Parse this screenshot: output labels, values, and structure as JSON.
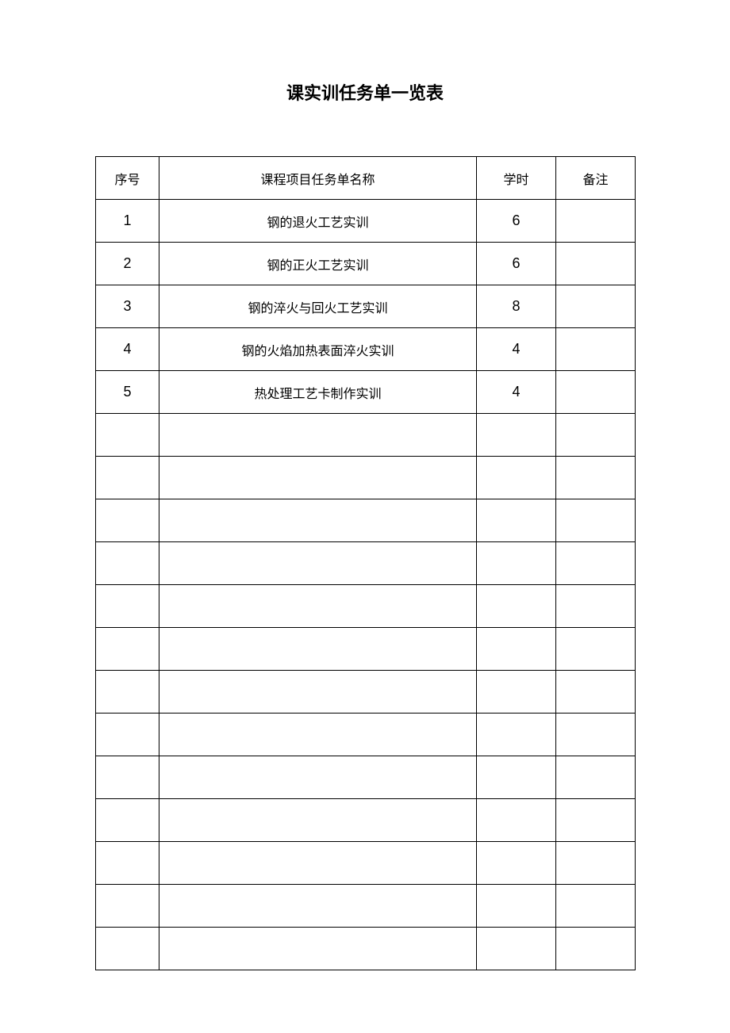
{
  "title": "课实训任务单一览表",
  "headers": {
    "index": "序号",
    "name": "课程项目任务单名称",
    "hours": "学时",
    "remark": "备注"
  },
  "rows": [
    {
      "index": "1",
      "name": "钢的退火工艺实训",
      "hours": "6",
      "remark": ""
    },
    {
      "index": "2",
      "name": "钢的正火工艺实训",
      "hours": "6",
      "remark": ""
    },
    {
      "index": "3",
      "name": "钢的淬火与回火工艺实训",
      "hours": "8",
      "remark": ""
    },
    {
      "index": "4",
      "name": "钢的火焰加热表面淬火实训",
      "hours": "4",
      "remark": ""
    },
    {
      "index": "5",
      "name": "热处理工艺卡制作实训",
      "hours": "4",
      "remark": ""
    },
    {
      "index": "",
      "name": "",
      "hours": "",
      "remark": ""
    },
    {
      "index": "",
      "name": "",
      "hours": "",
      "remark": ""
    },
    {
      "index": "",
      "name": "",
      "hours": "",
      "remark": ""
    },
    {
      "index": "",
      "name": "",
      "hours": "",
      "remark": ""
    },
    {
      "index": "",
      "name": "",
      "hours": "",
      "remark": ""
    },
    {
      "index": "",
      "name": "",
      "hours": "",
      "remark": ""
    },
    {
      "index": "",
      "name": "",
      "hours": "",
      "remark": ""
    },
    {
      "index": "",
      "name": "",
      "hours": "",
      "remark": ""
    },
    {
      "index": "",
      "name": "",
      "hours": "",
      "remark": ""
    },
    {
      "index": "",
      "name": "",
      "hours": "",
      "remark": ""
    },
    {
      "index": "",
      "name": "",
      "hours": "",
      "remark": ""
    },
    {
      "index": "",
      "name": "",
      "hours": "",
      "remark": ""
    },
    {
      "index": "",
      "name": "",
      "hours": "",
      "remark": ""
    }
  ]
}
